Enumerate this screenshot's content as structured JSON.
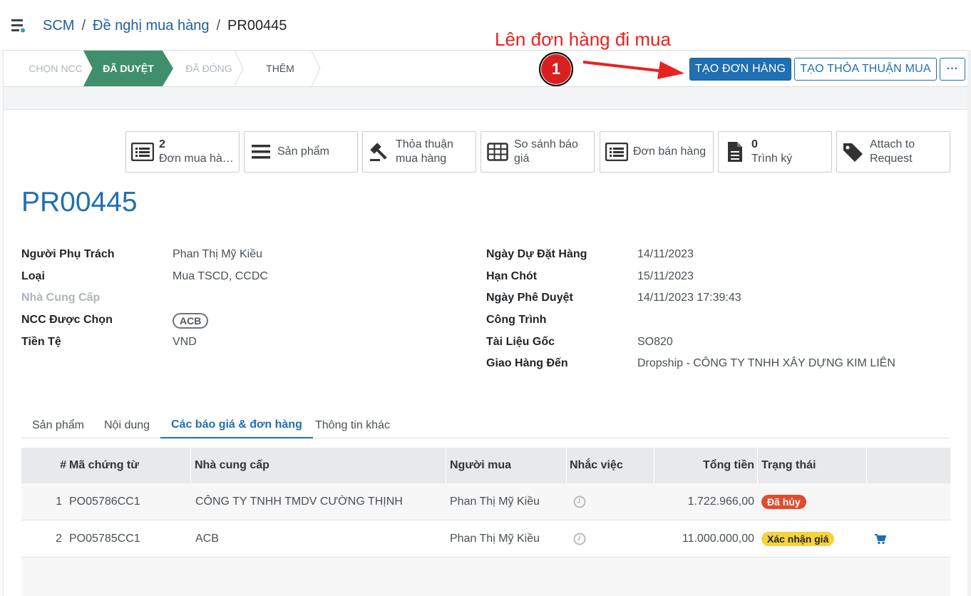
{
  "breadcrumb": {
    "root": "SCM",
    "parent": "Đề nghị mua hàng",
    "current": "PR00445"
  },
  "annotation": {
    "text": "Lên đơn hàng đi mua",
    "step": "1"
  },
  "stages": [
    "CHỌN NCC",
    "ĐÃ DUYỆT",
    "ĐÃ ĐÓNG",
    "THÊM"
  ],
  "actions": {
    "create_order": "TẠO ĐƠN HÀNG",
    "create_agreement": "TẠO THỎA THUẬN MUA",
    "more": "···"
  },
  "smart_buttons": [
    {
      "count": "2",
      "label": "Đơn mua hà…",
      "icon": "list-icon"
    },
    {
      "label": "Sản phẩm",
      "icon": "bars-icon"
    },
    {
      "label_line1": "Thỏa thuận",
      "label_line2": "mua hàng",
      "icon": "gavel-icon"
    },
    {
      "label_line1": "So sánh báo",
      "label_line2": "giá",
      "icon": "table-icon"
    },
    {
      "label": "Đơn bán hàng",
      "icon": "list-icon"
    },
    {
      "count": "0",
      "label": "Trình ký",
      "icon": "file-icon"
    },
    {
      "label_line1": "Attach to",
      "label_line2": "Request",
      "icon": "tags-icon"
    }
  ],
  "record": {
    "name": "PR00445"
  },
  "left_fields": {
    "owner_label": "Người Phụ Trách",
    "owner": "Phan Thị Mỹ Kiều",
    "type_label": "Loại",
    "type": "Mua TSCD, CCDC",
    "vendor_label": "Nhà Cung Cấp",
    "selected_vendor_label": "NCC Được Chọn",
    "selected_vendor": "ACB",
    "currency_label": "Tiền Tệ",
    "currency": "VND"
  },
  "right_fields": {
    "order_date_label": "Ngày Dự Đặt Hàng",
    "order_date": "14/11/2023",
    "deadline_label": "Hạn Chót",
    "deadline": "15/11/2023",
    "approve_date_label": "Ngày Phê Duyệt",
    "approve_date": "14/11/2023 17:39:43",
    "project_label": "Công Trình",
    "source_doc_label": "Tài Liệu Gốc",
    "source_doc": "SO820",
    "deliver_to_label": "Giao Hàng Đến",
    "deliver_to": "Dropship - CÔNG TY TNHH XÂY DỰNG KIM LIÊN"
  },
  "tabs": [
    "Sản phẩm",
    "Nội dung",
    "Các báo giá & đơn hàng",
    "Thông tin khác"
  ],
  "table": {
    "headers": {
      "num": "#",
      "code": "Mã chứng từ",
      "vendor": "Nhà cung cấp",
      "buyer": "Người mua",
      "reminder": "Nhắc việc",
      "total": "Tổng tiền",
      "status": "Trạng thái"
    },
    "rows": [
      {
        "num": "1",
        "code": "PO05786CC1",
        "vendor": "CÔNG TY TNHH TMDV CƯỜNG THỊNH",
        "buyer": "Phan Thị Mỹ Kiều",
        "total": "1.722.966,00",
        "status": "Đã hủy"
      },
      {
        "num": "2",
        "code": "PO05785CC1",
        "vendor": "ACB",
        "buyer": "Phan Thị Mỹ Kiều",
        "total": "11.000.000,00",
        "status": "Xác nhận giá"
      }
    ]
  },
  "colors": {
    "primary": "#1f6fb2",
    "stage_active": "#3f8f6c",
    "annotation": "#e8231f",
    "cancel_badge": "#e04b2e",
    "confirm_badge": "#f5d33e"
  }
}
